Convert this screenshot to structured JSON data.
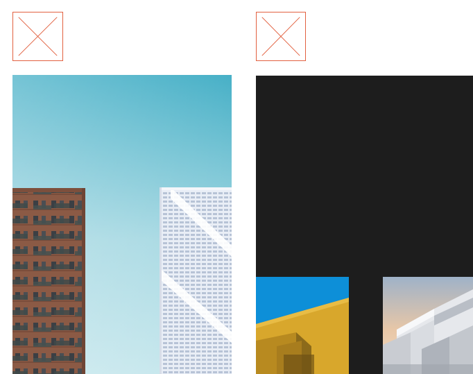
{
  "icons": {
    "left_placeholder": "close-icon",
    "right_placeholder": "close-icon"
  },
  "colors": {
    "placeholder_stroke": "#e2603f",
    "sky_top": "#47b0c7",
    "sky_bottom": "#bfe4ea",
    "brick": "#8b5a45",
    "panel_dark": "#1d1d1d",
    "blue_sky": "#0d8fd8",
    "yellow_facade": "#d8a72c"
  }
}
